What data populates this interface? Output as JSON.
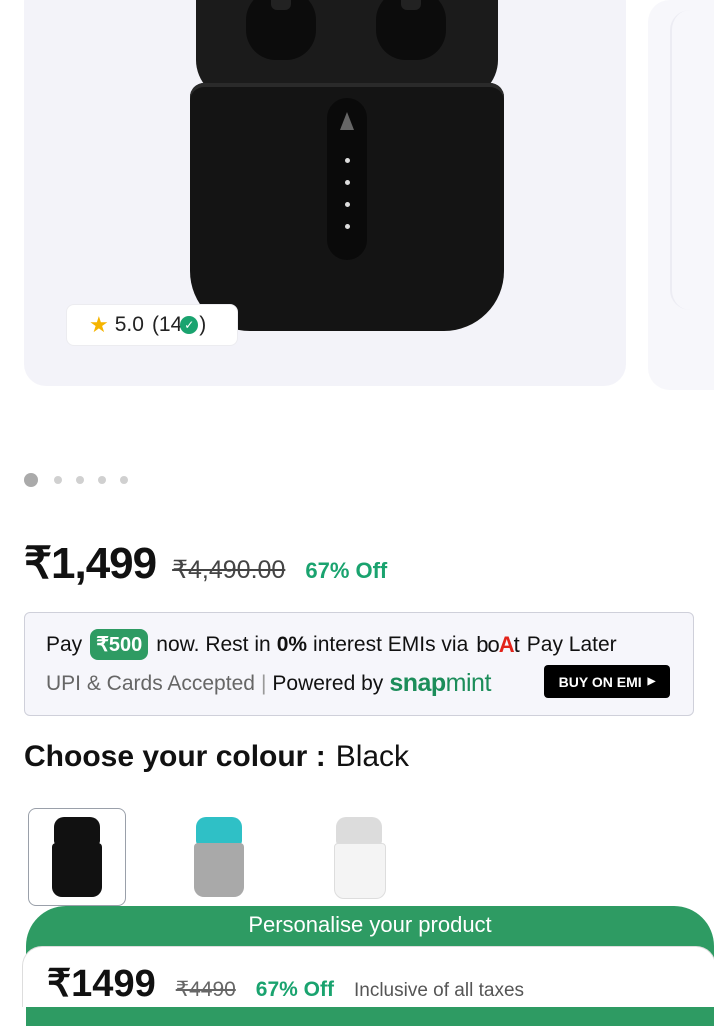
{
  "rating": {
    "score": "5.0",
    "count_prefix": "(14",
    "count_suffix": ")",
    "icon": "star-icon"
  },
  "carousel": {
    "total": 5,
    "active": 1
  },
  "pricing": {
    "price": "₹1,499",
    "mrp": "₹4,490.00",
    "discount": "67% Off"
  },
  "emi": {
    "pay": "Pay",
    "amount": "₹500",
    "rest": "now. Rest in",
    "zero": "0%",
    "interest": "interest EMIs via",
    "brand_b": "bo",
    "brand_a": "A",
    "brand_t": "t",
    "pay_later": "Pay Later",
    "upi": "UPI & Cards Accepted",
    "separator": "|",
    "powered": "Powered by",
    "snap": "snap",
    "mint": "mint",
    "buy_button": "BUY ON EMI"
  },
  "colour": {
    "heading": "Choose your colour :",
    "selected": "Black"
  },
  "swatches": [
    {
      "name": "Black",
      "lid": "#111111",
      "body": "#111111"
    },
    {
      "name": "Teal",
      "lid": "#2fc0c6",
      "body": "#a9a9a9"
    },
    {
      "name": "White",
      "lid": "#dcdcdc",
      "body": "#f4f4f4"
    }
  ],
  "personalise": {
    "label": "Personalise your product"
  },
  "sticky": {
    "price": "₹1499",
    "mrp": "₹4490",
    "discount": "67% Off",
    "tax_note": "Inclusive of all taxes"
  },
  "colors": {
    "green": "#2e9b63",
    "discount_green": "#1aa36f",
    "star": "#f5b400"
  }
}
